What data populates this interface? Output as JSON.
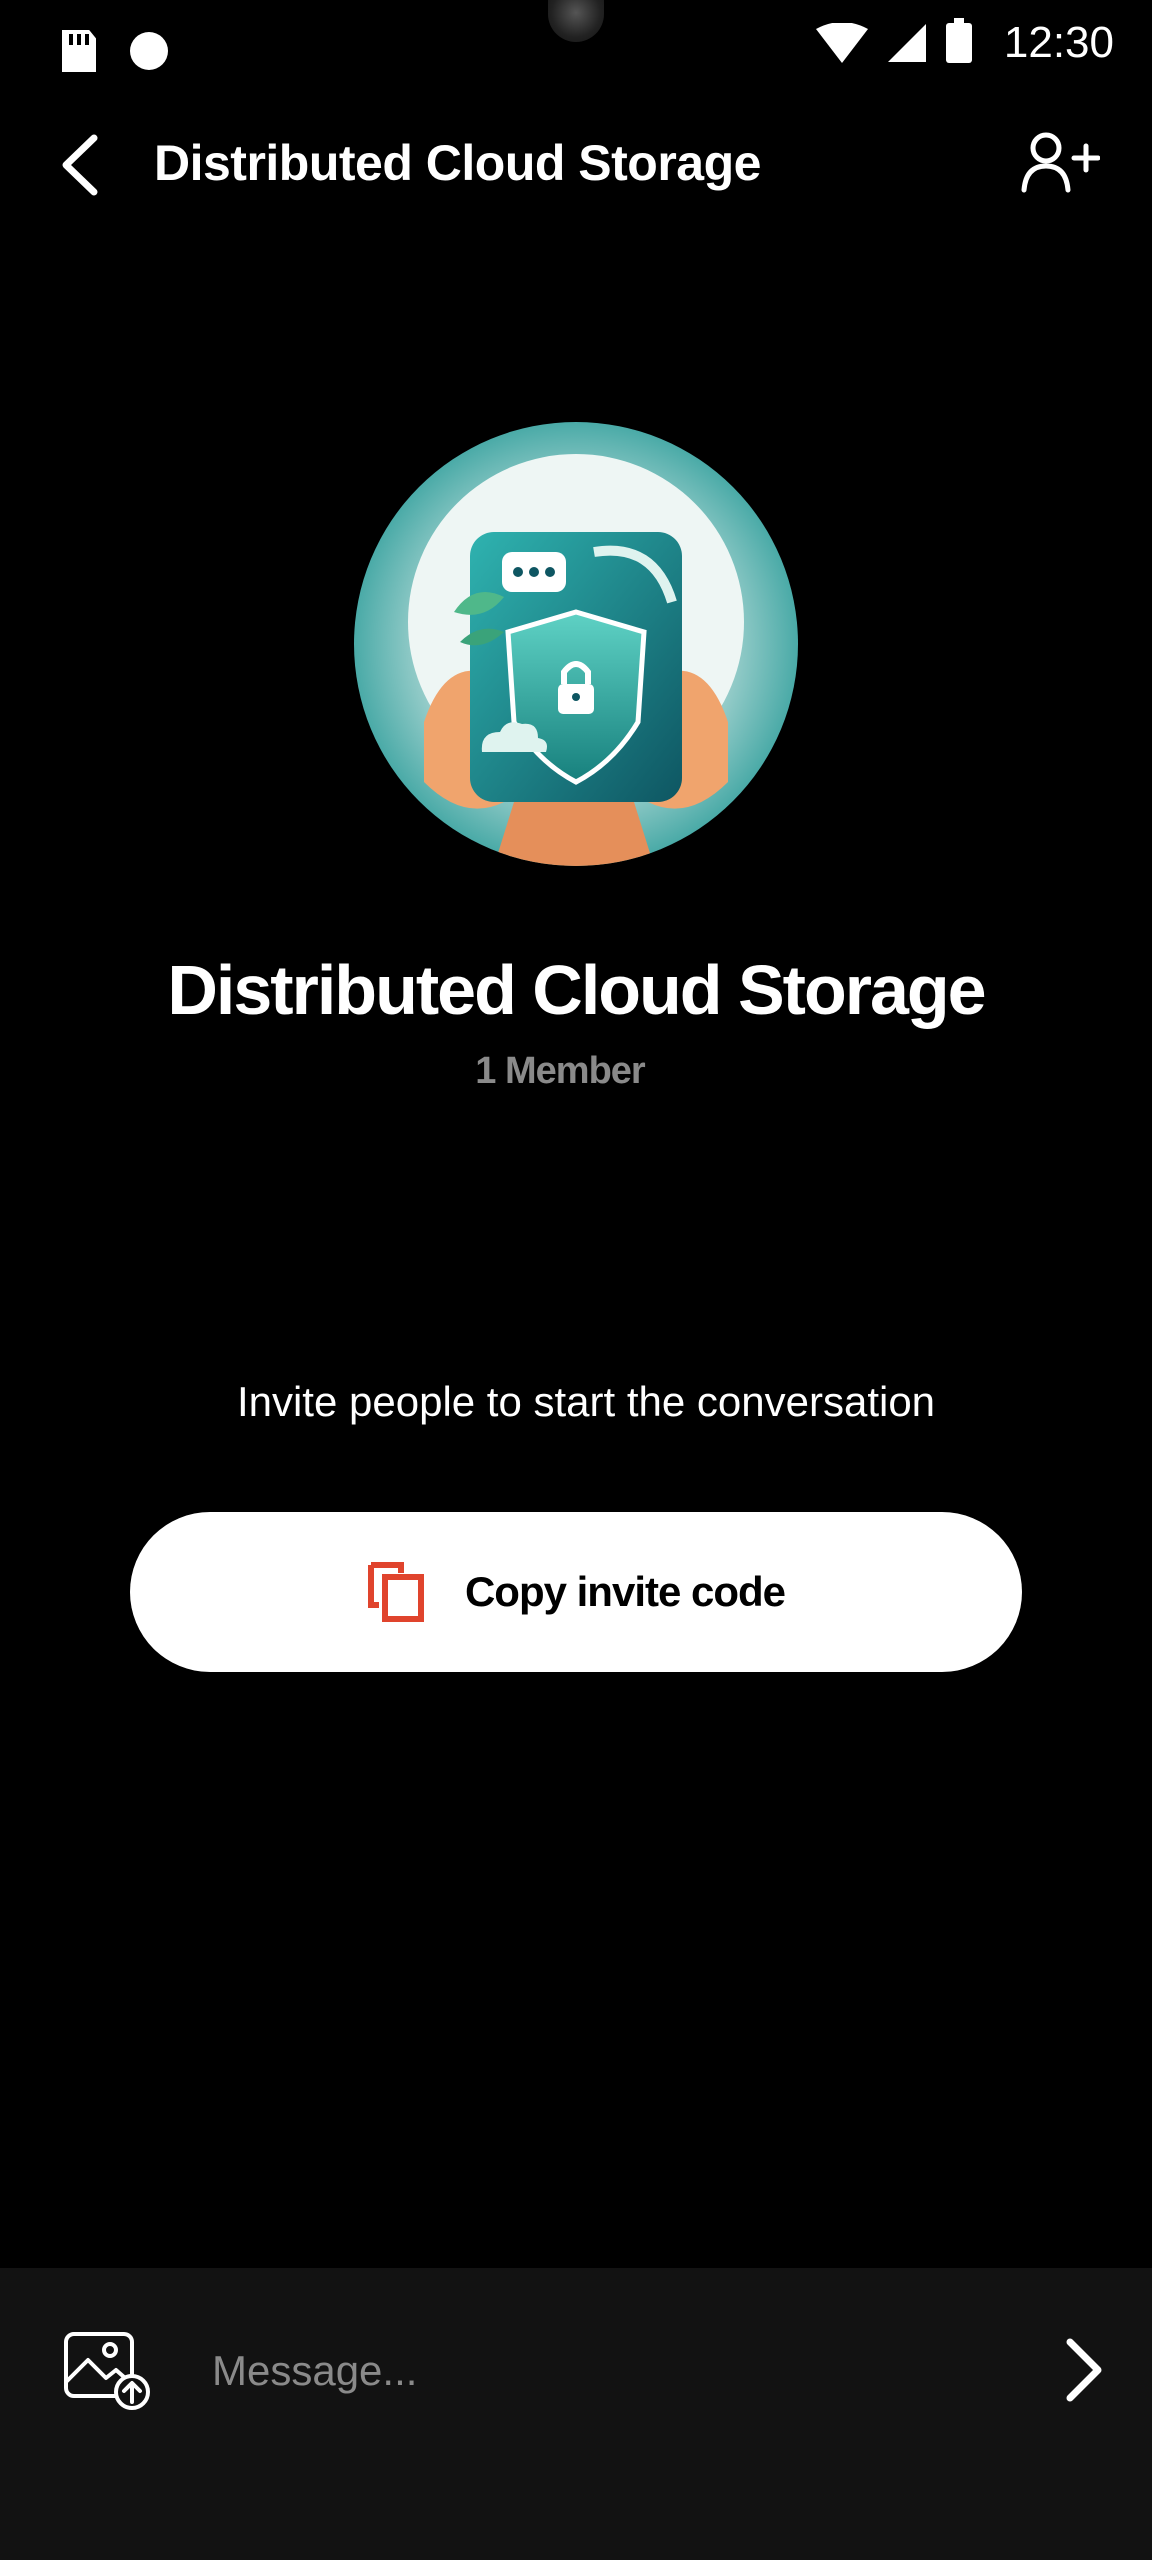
{
  "status_bar": {
    "time": "12:30",
    "icons": [
      "sd-card-icon",
      "notification-dot-icon",
      "wifi-icon",
      "cell-signal-icon",
      "battery-icon"
    ]
  },
  "header": {
    "title": "Distributed Cloud Storage",
    "back_icon": "chevron-left-icon",
    "add_member_icon": "person-add-icon"
  },
  "group": {
    "name": "Distributed Cloud Storage",
    "member_count": "1 Member",
    "avatar_description": "hands-holding-secure-tablet-illustration"
  },
  "empty_state": {
    "prompt": "Invite people to start the conversation",
    "copy_button_label": "Copy invite code",
    "copy_icon": "copy-icon"
  },
  "composer": {
    "placeholder": "Message...",
    "image_icon": "image-upload-icon",
    "send_icon": "chevron-right-icon"
  },
  "colors": {
    "background": "#000000",
    "composer_bg": "#121212",
    "accent_copy_icon": "#e0442d",
    "muted_text": "#8a8a8a"
  }
}
